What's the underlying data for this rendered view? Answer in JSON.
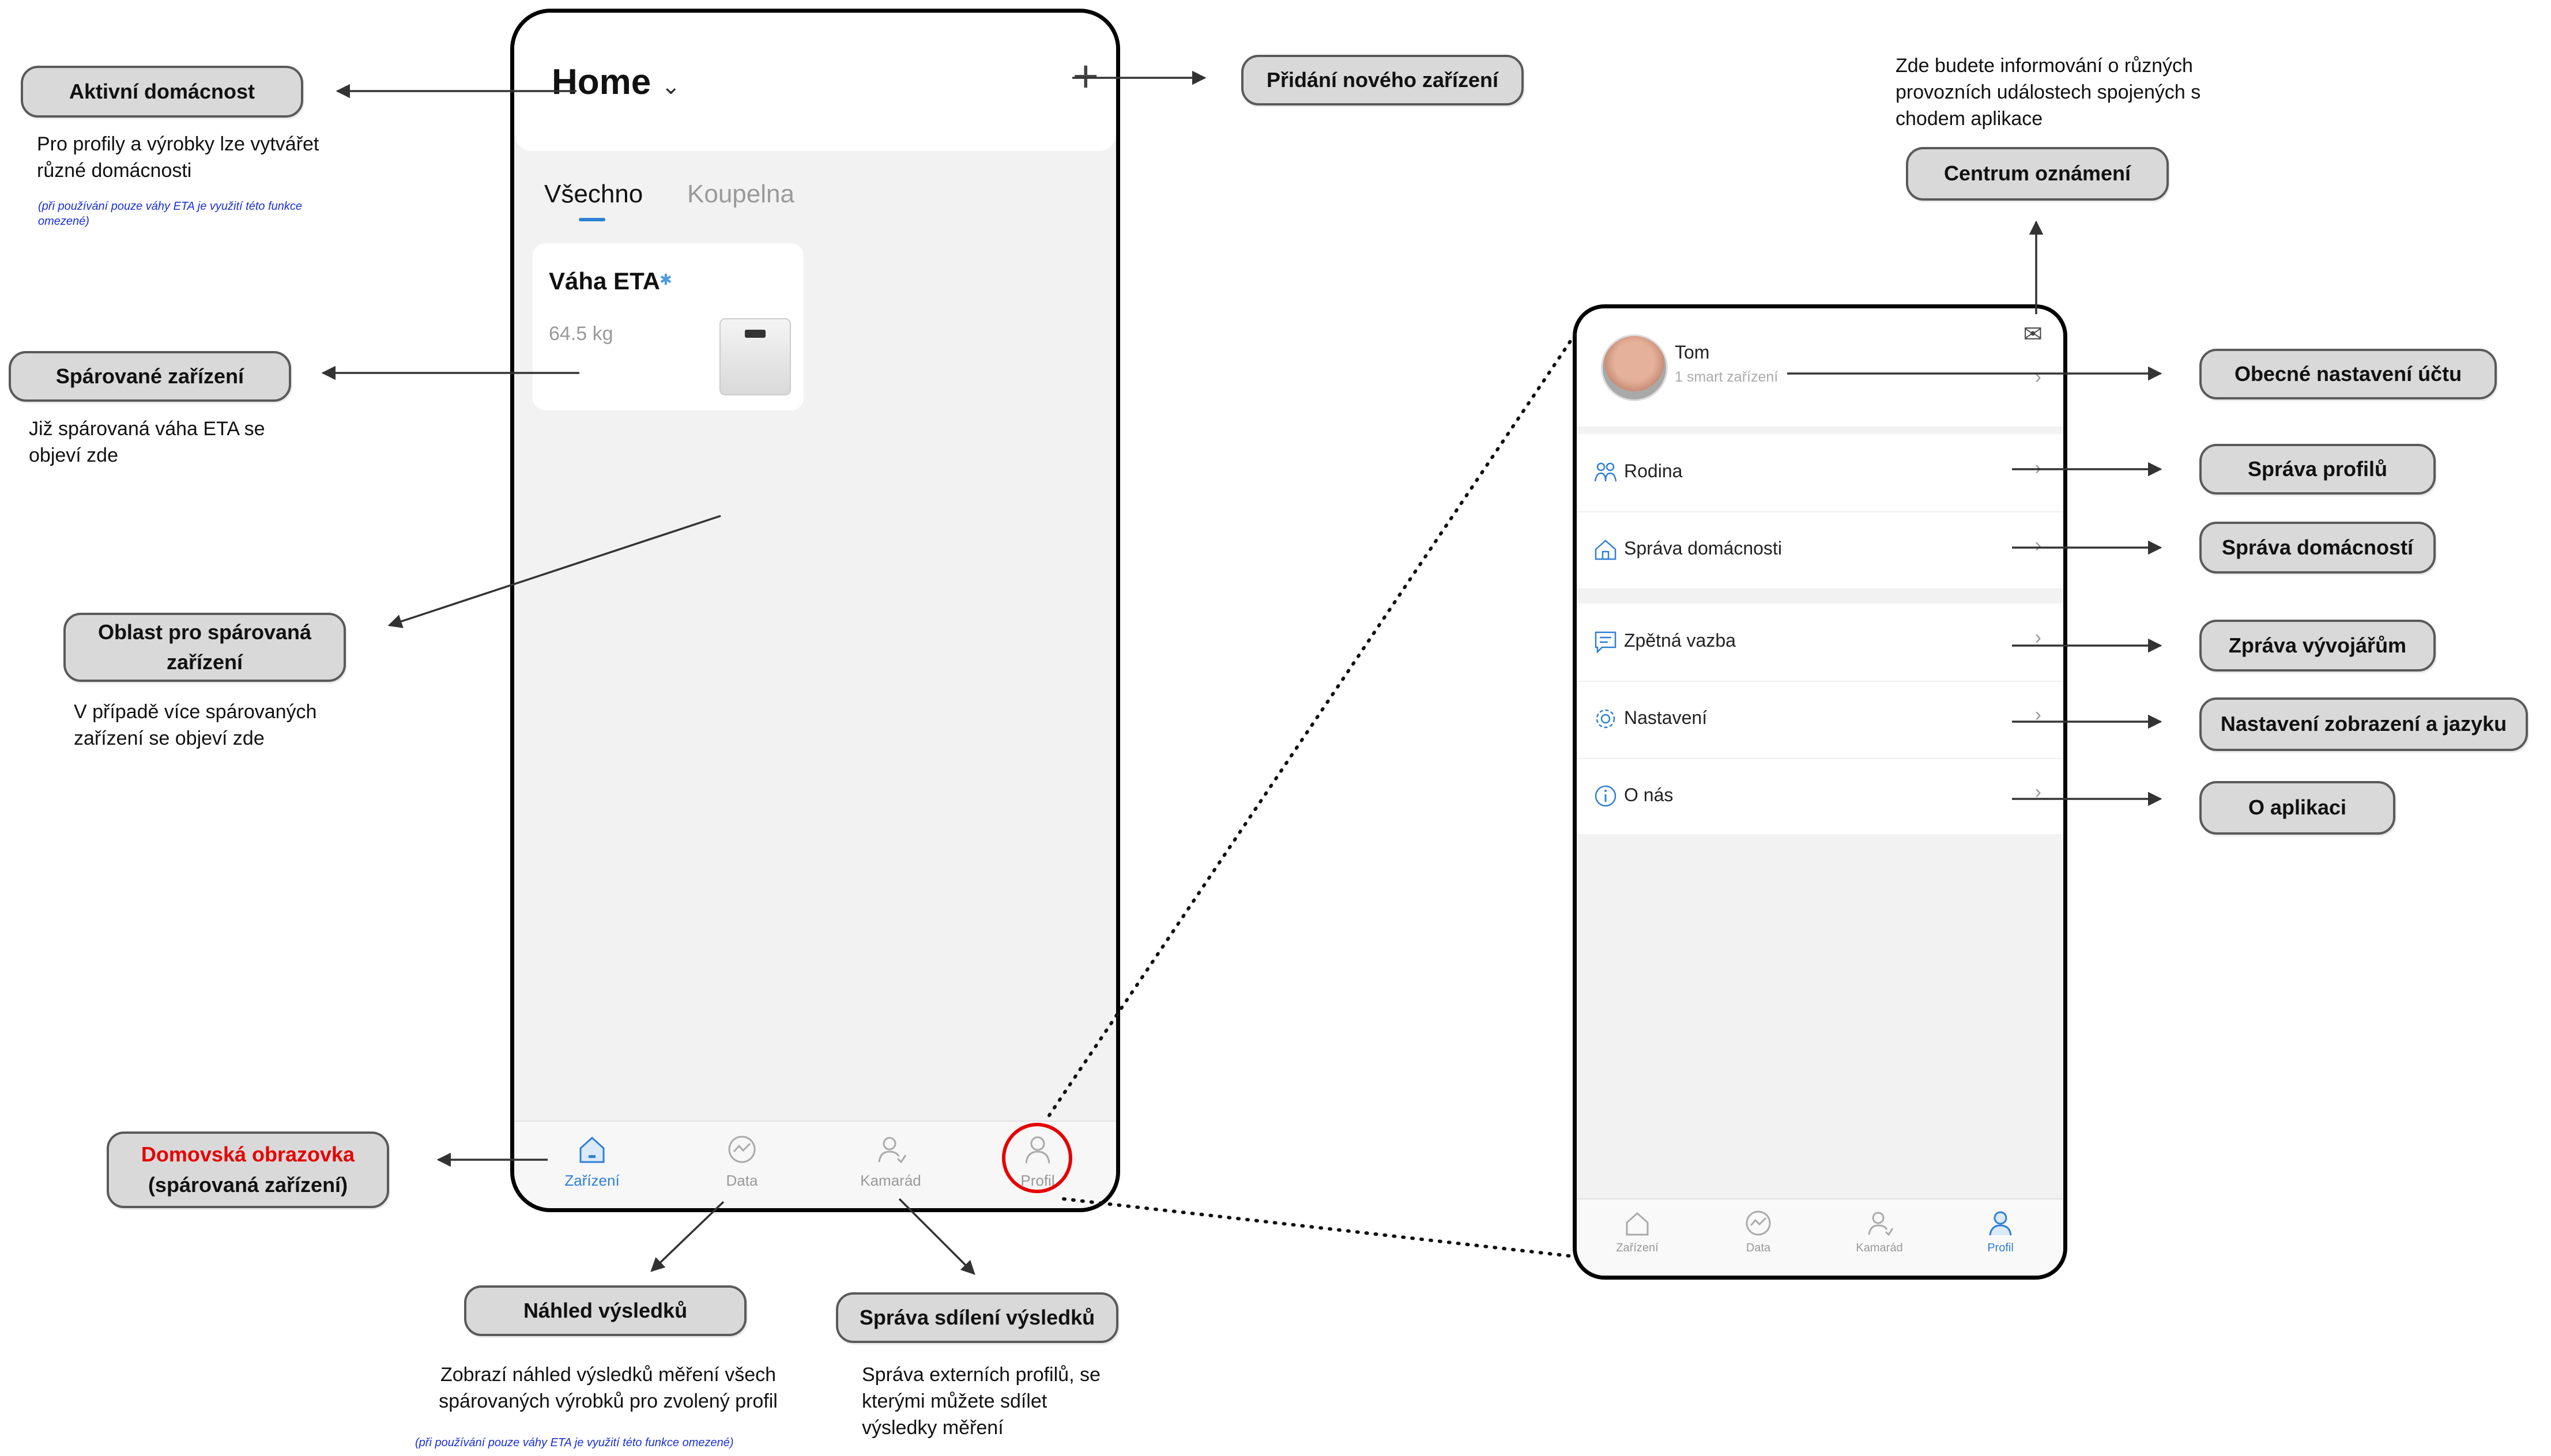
{
  "phone1": {
    "title": "Home",
    "tabs": [
      "Všechno",
      "Koupelna"
    ],
    "card": {
      "title": "Váha ETA",
      "weight": "64.5 kg"
    },
    "tabbar": [
      "Zařízení",
      "Data",
      "Kamarád",
      "Profil"
    ]
  },
  "phone2": {
    "name": "Tom",
    "subtitle": "1 smart zařízení",
    "menu": [
      "Rodina",
      "Správa domácnosti",
      "Zpětná vazba",
      "Nastavení",
      "O nás"
    ],
    "tabbar": [
      "Zařízení",
      "Data",
      "Kamarád",
      "Profil"
    ]
  },
  "callouts": {
    "active_household": "Aktivní domácnost",
    "paired_device": "Spárované zařízení",
    "paired_area": "Oblast pro spárovaná zařízení",
    "home_screen_red": "Domovská obrazovka",
    "home_screen_sub": "(spárovaná zařízení)",
    "results_preview": "Náhled výsledků",
    "share_management": "Správa sdílení výsledků",
    "add_device": "Přidání nového zařízení",
    "notification_center": "Centrum oznámení",
    "account_settings": "Obecné nastavení účtu",
    "profile_management": "Správa profilů",
    "household_management": "Správa domácností",
    "developer_message": "Zpráva vývojářům",
    "display_language": "Nastavení zobrazení a jazyku",
    "about_app": "O aplikaci"
  },
  "descriptions": {
    "household_desc": "Pro profily a výrobky lze vytvářet různé domácnosti",
    "household_note": "(při používání pouze váhy ETA je využití této funkce omezené)",
    "paired_desc": "Již spárovaná váha ETA se objeví zde",
    "area_desc": "V případě více spárovaných zařízení se objeví zde",
    "preview_desc": "Zobrazí náhled výsledků měření všech spárovaných výrobků pro zvolený profil",
    "preview_note": "(při používání pouze váhy ETA je využití této funkce omezené)",
    "share_desc": "Správa externích profilů, se kterými můžete sdílet výsledky měření",
    "notification_desc": "Zde budete informování o různých provozních událostech spojených s chodem aplikace"
  },
  "colors": {
    "accent": "#2f7fd6",
    "callout_fill": "#d9d9d9",
    "highlight": "#e60000",
    "note": "#1a2fd6"
  },
  "icons": [
    "home-icon",
    "data-chart-icon",
    "friend-icon",
    "profile-icon",
    "plus-icon",
    "chevron-down-icon",
    "mail-icon",
    "family-icon",
    "house-icon",
    "feedback-icon",
    "gear-icon",
    "info-icon",
    "chevron-right-icon",
    "bluetooth-icon"
  ]
}
